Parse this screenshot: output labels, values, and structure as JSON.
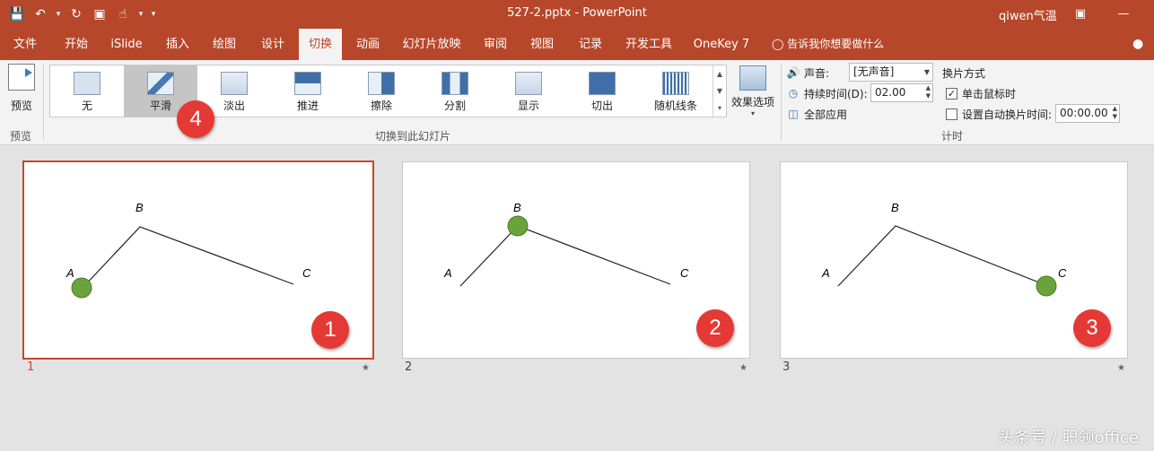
{
  "titlebar": {
    "doc_title": "527-2.pptx  -  PowerPoint",
    "user": "qiwen气温",
    "qat": [
      "save-icon",
      "undo-icon",
      "redo-icon",
      "slideshow-icon",
      "touch-mode-icon",
      "customize-icon"
    ],
    "restore_icon": "ribbon-display-icon",
    "minimize_icon": "minimize-icon"
  },
  "menu": {
    "tabs": [
      "文件",
      "开始",
      "iSlide",
      "插入",
      "绘图",
      "设计",
      "切换",
      "动画",
      "幻灯片放映",
      "审阅",
      "视图",
      "记录",
      "开发工具",
      "OneKey 7"
    ],
    "active_tab": "切换",
    "tellme": "告诉我你想要做什么"
  },
  "ribbon": {
    "preview_label": "预览",
    "preview_group": "预览",
    "gallery_group": "切换到此幻灯片",
    "transitions": [
      "无",
      "平滑",
      "淡出",
      "推进",
      "擦除",
      "分割",
      "显示",
      "切出",
      "随机线条"
    ],
    "selected_transition": "平滑",
    "effect_options": "效果选项",
    "timing": {
      "sound_label": "声音:",
      "sound_value": "[无声音]",
      "duration_label": "持续时间(D):",
      "duration_value": "02.00",
      "apply_all": "全部应用",
      "advance_label": "换片方式",
      "on_click": "单击鼠标时",
      "on_click_checked": true,
      "auto_after": "设置自动换片时间:",
      "auto_after_checked": false,
      "auto_value": "00:00.00",
      "group_label": "计时"
    }
  },
  "slides": [
    {
      "number": "1",
      "point_labels": [
        "A",
        "B",
        "C"
      ],
      "dot_at": "A",
      "badge": "1",
      "selected": true
    },
    {
      "number": "2",
      "point_labels": [
        "A",
        "B",
        "C"
      ],
      "dot_at": "B",
      "badge": "2",
      "selected": false
    },
    {
      "number": "3",
      "point_labels": [
        "A",
        "B",
        "C"
      ],
      "dot_at": "C",
      "badge": "3",
      "selected": false
    }
  ],
  "slide_mark": "★",
  "callout_badge": "4",
  "dot_color": "#6aa23c",
  "accent_color": "#b7472a",
  "badge_color": "#e53935",
  "watermark": "头条号 / 职领office"
}
